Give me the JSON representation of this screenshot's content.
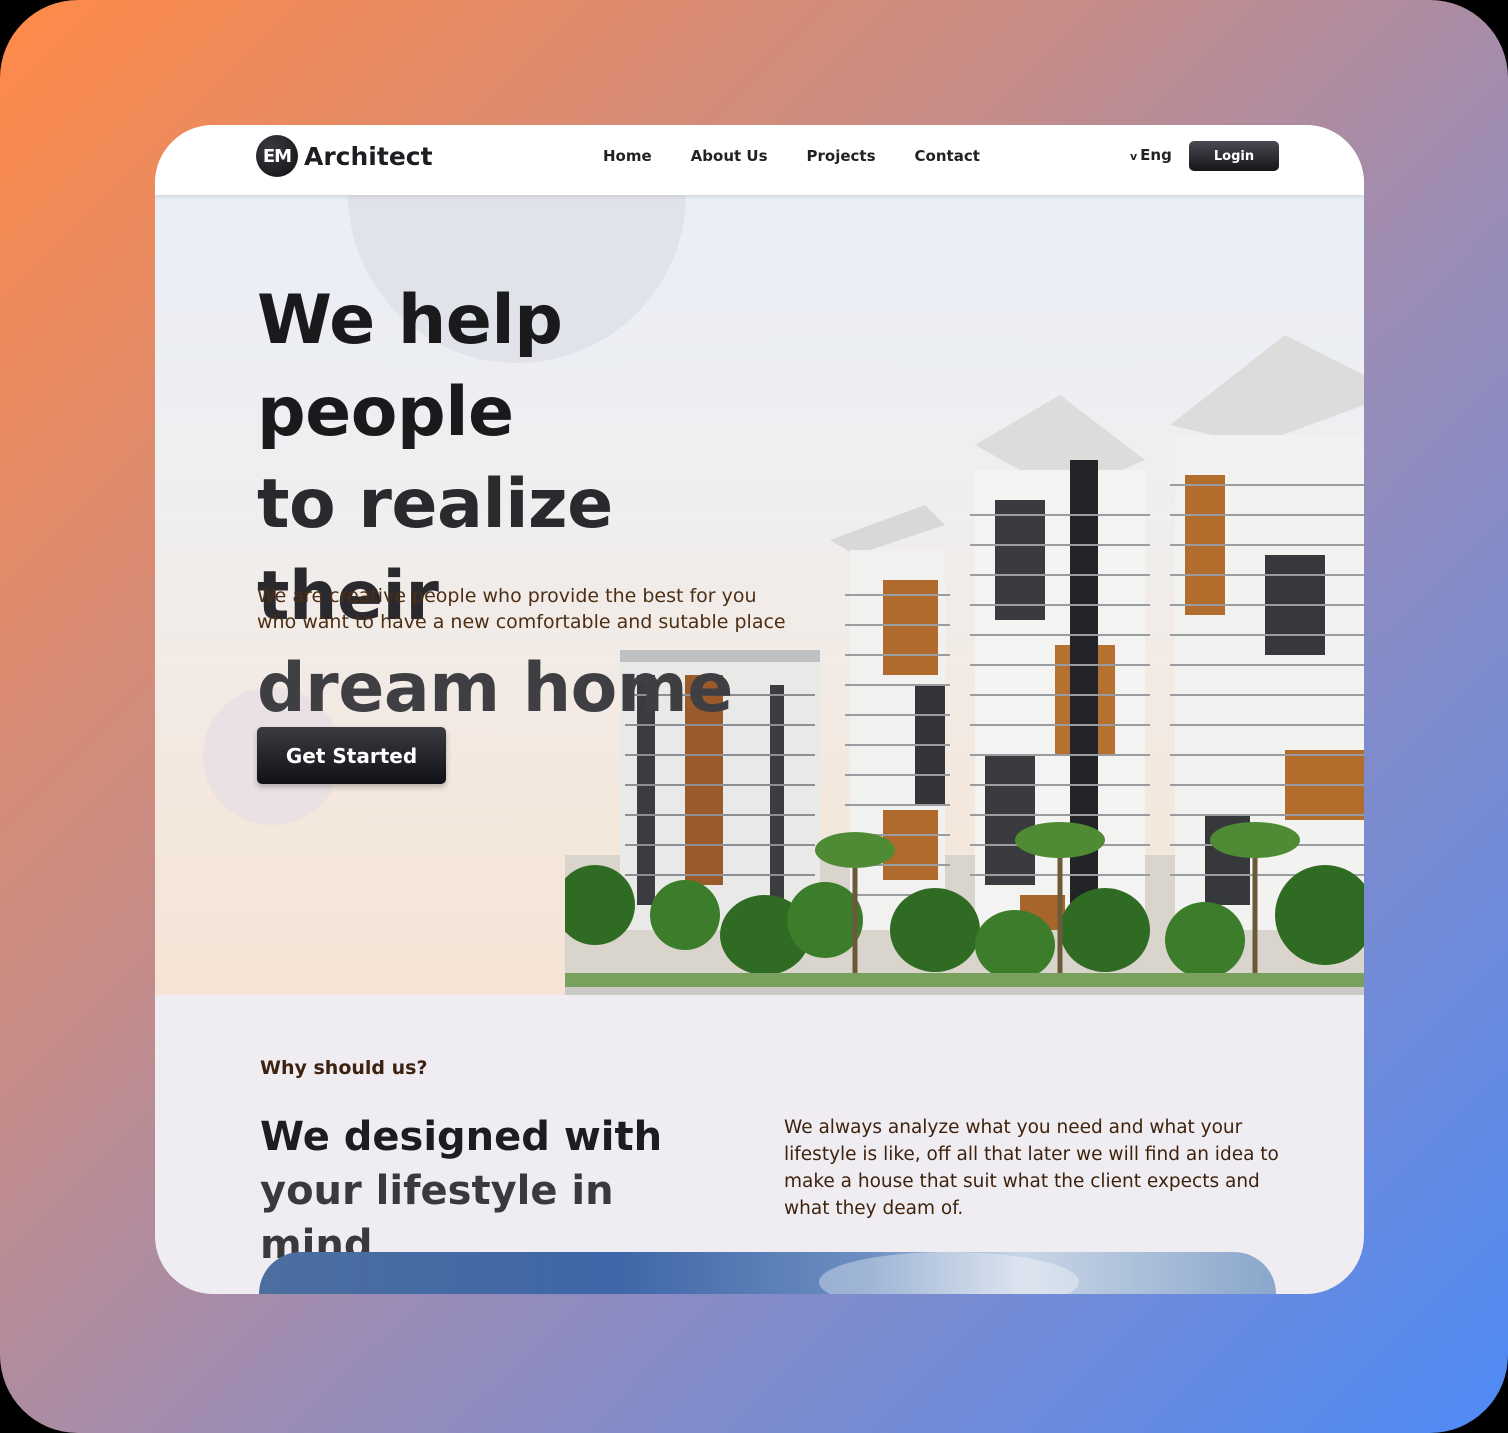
{
  "header": {
    "logo_badge": "EM",
    "logo_text": "Architect",
    "nav": [
      "Home",
      "About Us",
      "Projects",
      "Contact"
    ],
    "language": "Eng",
    "login_label": "Login"
  },
  "hero": {
    "headline": [
      "We help people",
      "to realize their",
      "dream home"
    ],
    "subtitle": "We are creative people who provide the best for you who want to have a new comfortable and sutable place",
    "cta_label": "Get Started"
  },
  "why": {
    "label": "Why should us?",
    "title": [
      "We designed with",
      "your lifestyle in mind"
    ],
    "text": "We always analyze what you need and what your lifestyle is like, off all that later we will find an idea to make a house that suit what the client expects and what they deam of."
  },
  "colors": {
    "accent_dark": "#141519",
    "text_brown": "#4e2e12",
    "bg_gradient_start": "#ff8a48",
    "bg_gradient_end": "#4d8af5"
  }
}
